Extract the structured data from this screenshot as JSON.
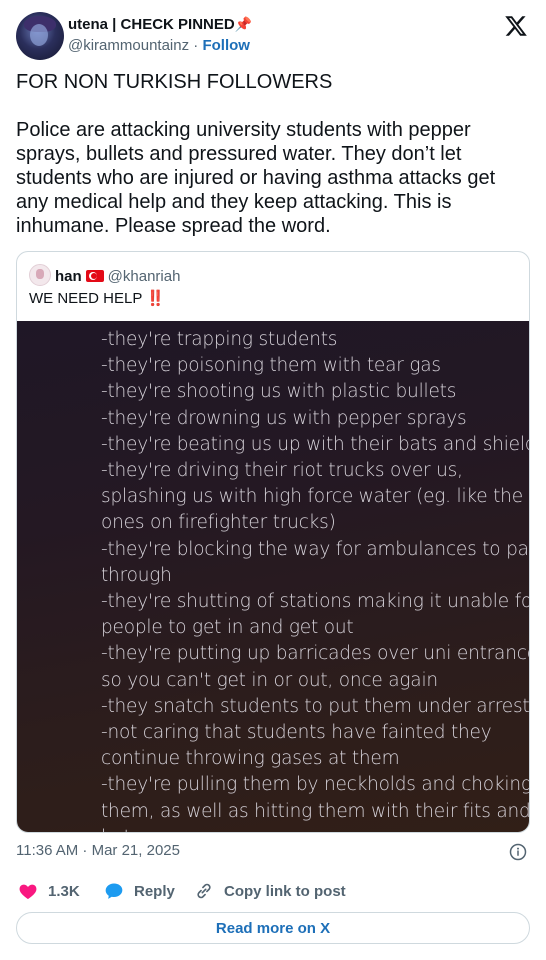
{
  "author": {
    "display_name": "utena | CHECK PINNED",
    "pin_emoji": "📌",
    "handle": "@kirammountainz",
    "separator": "·",
    "follow_label": "Follow"
  },
  "tweet": {
    "text": "FOR NON TURKISH FOLLOWERS\n\nPolice are attacking university students with pepper sprays, bullets and pressured water. They don’t let students who are injured or having asthma attacks get any medical help and they keep attacking. This is inhumane. Please spread the word.",
    "timestamp": "11:36 AM · Mar 21, 2025"
  },
  "quote": {
    "name": "han",
    "handle": "@khanriah",
    "text": "WE NEED HELP",
    "emoji": "‼️",
    "image_lines": [
      "-they're trapping students",
      "-they're poisoning them with tear gas",
      "-they're shooting us with plastic bullets",
      "-they're drowning us with pepper sprays",
      "-they're beating us up with their bats and shields",
      "-they're driving their riot trucks over us,",
      "splashing us with high force water (eg. like the",
      "ones on firefighter trucks)",
      "-they're blocking the way for ambulances to pass",
      "through",
      "-they're shutting of stations making it unable for",
      "people to get in and get out",
      "-they're putting up barricades over uni entrances",
      "so you can't get in or out, once again",
      "-they snatch students to put them under arrest",
      "-not caring that students have fainted they",
      "continue throwing gases at them",
      "-they're pulling them by neckholds and choking",
      "them, as well as hitting them with their fits and",
      "bats"
    ]
  },
  "actions": {
    "like_count": "1.3K",
    "reply_label": "Reply",
    "copy_label": "Copy link to post"
  },
  "read_more_label": "Read more on X",
  "colors": {
    "like": "#f91880",
    "reply": "#1d9bf0",
    "link": "#1d6fb8",
    "muted": "#536471"
  },
  "icons": [
    "x-logo-icon",
    "pin-icon",
    "turkey-flag-icon",
    "double-exclamation-icon",
    "info-icon",
    "heart-icon",
    "reply-bubble-icon",
    "link-icon"
  ]
}
